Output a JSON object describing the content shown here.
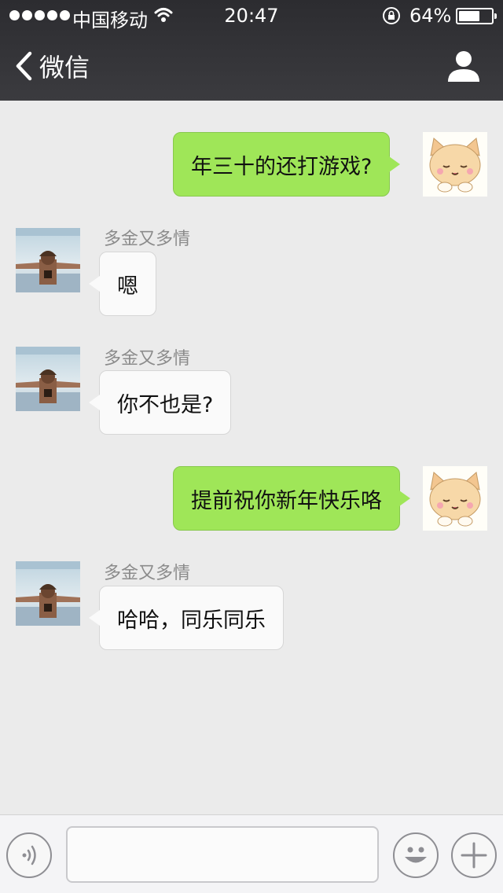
{
  "status_bar": {
    "carrier": "中国移动",
    "time": "20:47",
    "battery_percent": "64%",
    "battery_level": 0.64,
    "icons": [
      "signal-dots-icon",
      "wifi-icon",
      "rotation-lock-icon",
      "battery-icon"
    ]
  },
  "nav": {
    "back_label": "微信",
    "icons": [
      "back-chevron-icon",
      "profile-icon"
    ]
  },
  "messages": [
    {
      "direction": "out",
      "text": "年三十的还打游戏?"
    },
    {
      "direction": "in",
      "sender": "多金又多情",
      "text": "嗯"
    },
    {
      "direction": "in",
      "sender": "多金又多情",
      "text": "你不也是?"
    },
    {
      "direction": "out",
      "text": "提前祝你新年快乐咯"
    },
    {
      "direction": "in",
      "sender": "多金又多情",
      "text": "哈哈，同乐同乐"
    }
  ],
  "input_bar": {
    "value": "",
    "icons": [
      "voice-icon",
      "emoji-icon",
      "plus-icon"
    ]
  },
  "colors": {
    "outgoing_bubble": "#9fe658",
    "incoming_bubble": "#fafafa",
    "chat_background": "#ebebeb",
    "top_bar": "#333337"
  }
}
